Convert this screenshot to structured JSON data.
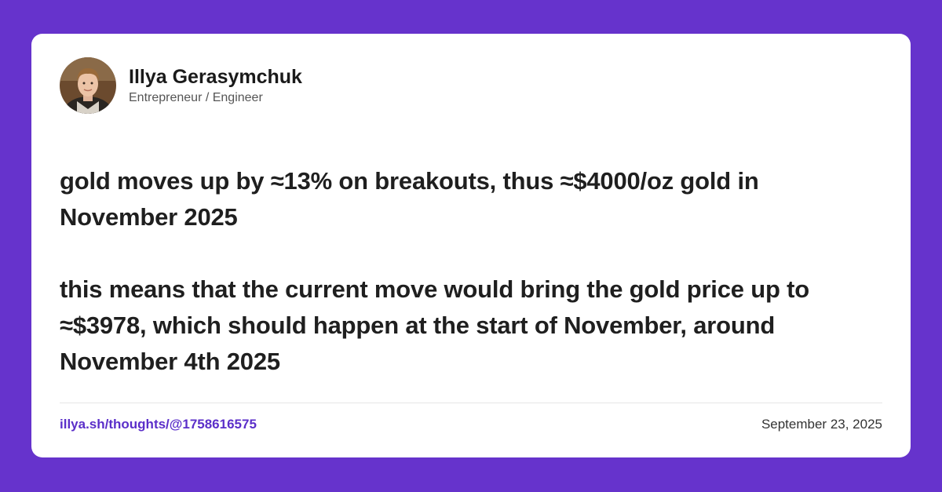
{
  "colors": {
    "background": "#6633cc",
    "card": "#ffffff",
    "link": "#5b2fc9",
    "text": "#1f1f1f"
  },
  "author": {
    "name": "Illya Gerasymchuk",
    "role": "Entrepreneur / Engineer",
    "avatar_icon": "profile-photo"
  },
  "post": {
    "paragraphs": [
      "gold moves up by ≈13% on breakouts, thus ≈$4000/oz gold in November 2025",
      "this means that the current move would bring the gold price up to ≈$3978, which should happen at the start of November, around November 4th 2025"
    ]
  },
  "footer": {
    "link_text": "illya.sh/thoughts/@1758616575",
    "date": "September 23, 2025"
  }
}
